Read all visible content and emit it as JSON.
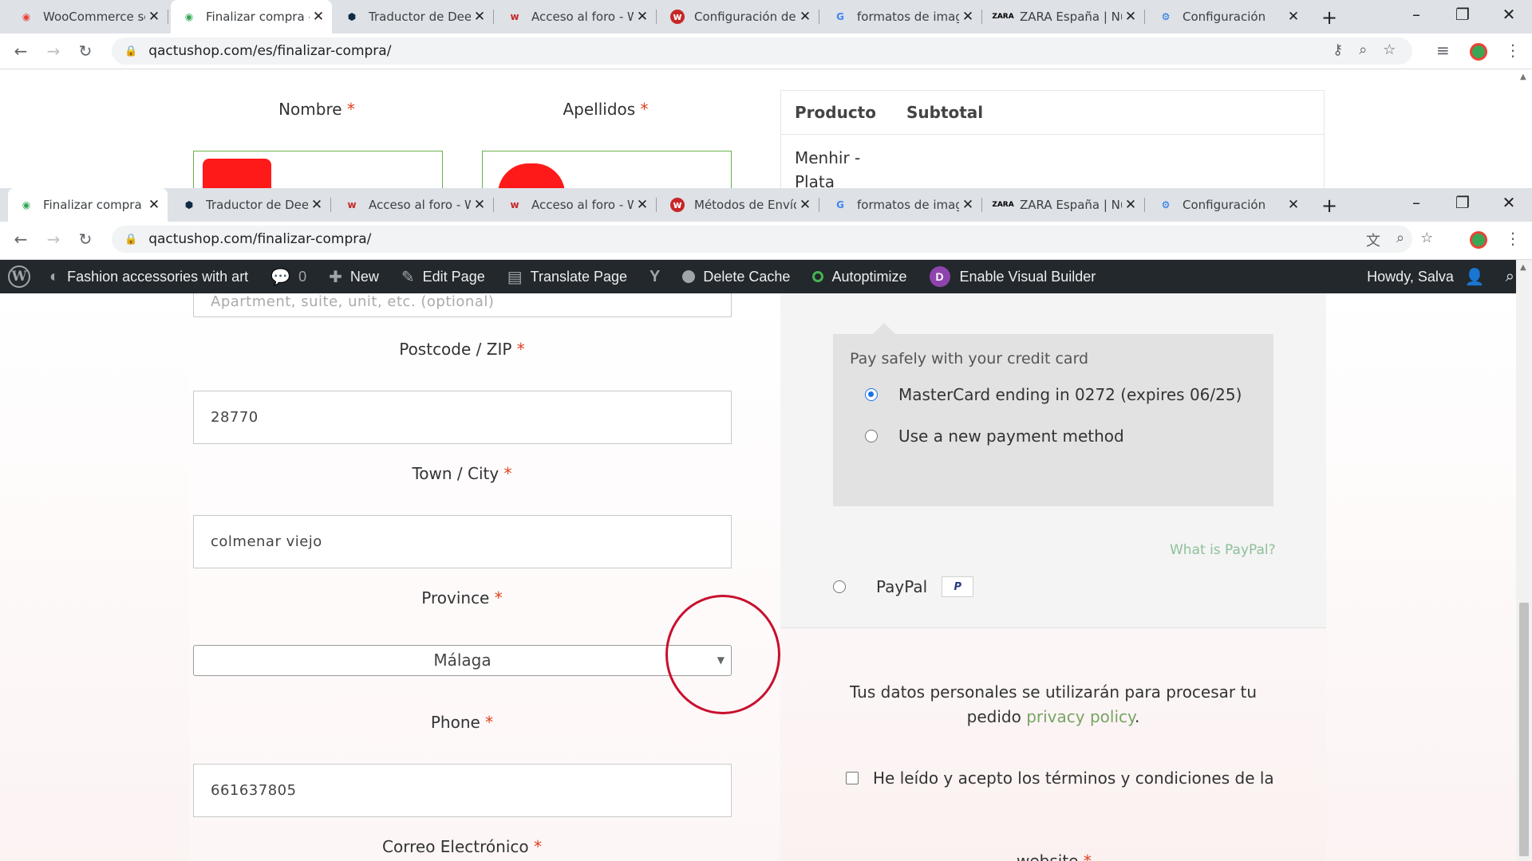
{
  "window_back": {
    "tabs": [
      {
        "label": "WooCommerce se",
        "icon": "woocommerce-icon",
        "active": false
      },
      {
        "label": "Finalizar compra -",
        "icon": "store-icon",
        "active": true
      },
      {
        "label": "Traductor de Deep",
        "icon": "deepl-icon",
        "active": false
      },
      {
        "label": "Acceso al foro - W",
        "icon": "woocommerce-w-icon",
        "active": false
      },
      {
        "label": "Configuración de",
        "icon": "woo-red-icon",
        "active": false
      },
      {
        "label": "formatos de image",
        "icon": "google-icon",
        "active": false
      },
      {
        "label": "ZARA España | Nu",
        "icon": "zara-icon",
        "active": false
      },
      {
        "label": "Configuración",
        "icon": "gear-icon",
        "active": false
      }
    ],
    "url": "qactushop.com/es/finalizar-compra/"
  },
  "back_page": {
    "first_name_label": "Nombre",
    "last_name_label": "Apellidos",
    "req_mark": "*",
    "review": {
      "product_header": "Producto",
      "subtotal_header": "Subtotal",
      "product_name": "Menhir - Plata"
    }
  },
  "window_front": {
    "tabs": [
      {
        "label": "Finalizar compra -",
        "icon": "store-icon",
        "active": true
      },
      {
        "label": "Traductor de Deep",
        "icon": "deepl-icon",
        "active": false
      },
      {
        "label": "Acceso al foro - W",
        "icon": "woocommerce-w-icon",
        "active": false
      },
      {
        "label": "Acceso al foro - W",
        "icon": "woocommerce-w-icon",
        "active": false
      },
      {
        "label": "Métodos de Envío",
        "icon": "woo-red-icon",
        "active": false
      },
      {
        "label": "formatos de image",
        "icon": "google-icon",
        "active": false
      },
      {
        "label": "ZARA España | Nu",
        "icon": "zara-icon",
        "active": false
      },
      {
        "label": "Configuración",
        "icon": "gear-icon",
        "active": false
      }
    ],
    "url": "qactushop.com/finalizar-compra/"
  },
  "wp_admin": {
    "site_name": "Fashion accessories with art",
    "comments_count": "0",
    "new_label": "New",
    "edit_page_label": "Edit Page",
    "translate_label": "Translate Page",
    "delete_cache_label": "Delete Cache",
    "autoptimize_label": "Autoptimize",
    "visual_builder_label": "Enable Visual Builder",
    "howdy_label": "Howdy, Salva"
  },
  "form": {
    "apartment_placeholder": "Apartment, suite, unit, etc. (optional)",
    "postcode_label": "Postcode / ZIP",
    "postcode_value": "28770",
    "city_label": "Town / City",
    "city_value": "colmenar viejo",
    "province_label": "Province",
    "province_value": "Málaga",
    "phone_label": "Phone",
    "phone_value": "661637805",
    "email_label": "Correo Electrónico",
    "req_mark": "*"
  },
  "payment": {
    "cc_title": "Pay safely with your credit card",
    "saved_card": "MasterCard ending in 0272 (expires 06/25)",
    "new_method": "Use a new payment method",
    "what_is_paypal": "What is PayPal?",
    "paypal_label": "PayPal",
    "paypal_badge": "P"
  },
  "legal": {
    "privacy_text": "Tus datos personales se utilizarán para procesar tu pedido",
    "privacy_link": "privacy policy",
    "privacy_end": ".",
    "terms_text": "He leído y acepto los términos y condiciones de la",
    "terms_tail": "website",
    "req_mark": "*"
  },
  "colors": {
    "accent_green": "#77a464",
    "required_red": "#e2401c",
    "annotation_red": "#c8102e",
    "wp_bar": "#23282d"
  }
}
